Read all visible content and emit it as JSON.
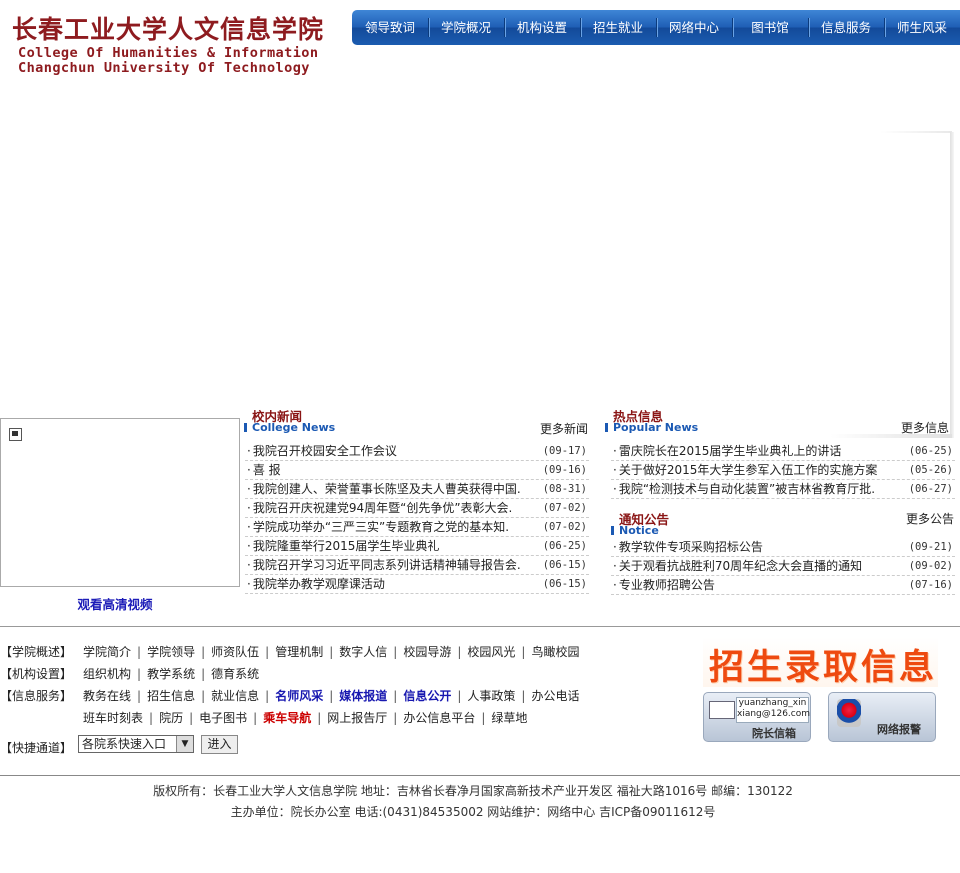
{
  "logo": {
    "name_cn": "长春工业大学人文信息学院",
    "name_en_1": "College Of Humanities & Information",
    "name_en_2": "Changchun University Of Technology"
  },
  "nav": [
    "领导致词",
    "学院概况",
    "机构设置",
    "招生就业",
    "网络中心",
    "图书馆",
    "信息服务",
    "师生风采"
  ],
  "video": {
    "link_label": "观看高清视频"
  },
  "campus_news": {
    "title_cn": "校内新闻",
    "title_en": "College News",
    "more": "更多新闻",
    "items": [
      {
        "title": "我院召开校园安全工作会议",
        "date": "(09-17)"
      },
      {
        "title": "喜 报",
        "date": "(09-16)"
      },
      {
        "title": "我院创建人、荣誉董事长陈坚及夫人曹英获得中国.",
        "date": "(08-31)"
      },
      {
        "title": "我院召开庆祝建党94周年暨“创先争优”表彰大会.",
        "date": "(07-02)"
      },
      {
        "title": "学院成功举办“三严三实”专题教育之党的基本知.",
        "date": "(07-02)"
      },
      {
        "title": "我院隆重举行2015届学生毕业典礼",
        "date": "(06-25)"
      },
      {
        "title": "我院召开学习习近平同志系列讲话精神辅导报告会.",
        "date": "(06-15)"
      },
      {
        "title": "我院举办教学观摩课活动",
        "date": "(06-15)"
      }
    ]
  },
  "hot_info": {
    "title_cn": "热点信息",
    "title_en": "Popular  News",
    "more": "更多信息",
    "items": [
      {
        "title": "雷庆院长在2015届学生毕业典礼上的讲话",
        "date": "(06-25)"
      },
      {
        "title": "关于做好2015年大学生参军入伍工作的实施方案",
        "date": "(05-26)"
      },
      {
        "title": "我院“检测技术与自动化装置”被吉林省教育厅批.",
        "date": "(06-27)"
      }
    ]
  },
  "notice": {
    "title_cn": "通知公告",
    "title_en": "Notice",
    "more": "更多公告",
    "items": [
      {
        "title": "教学软件专项采购招标公告",
        "date": "(09-21)"
      },
      {
        "title": "关于观看抗战胜利70周年纪念大会直播的通知",
        "date": "(09-02)"
      },
      {
        "title": "专业教师招聘公告",
        "date": "(07-16)"
      }
    ]
  },
  "quick_links": [
    {
      "label": "【学院概述】",
      "links": [
        {
          "t": "学院简介"
        },
        {
          "t": "学院领导"
        },
        {
          "t": "师资队伍"
        },
        {
          "t": "管理机制"
        },
        {
          "t": "数字人信"
        },
        {
          "t": "校园导游"
        },
        {
          "t": "校园风光"
        },
        {
          "t": "鸟瞰校园"
        }
      ]
    },
    {
      "label": "【机构设置】",
      "links": [
        {
          "t": "组织机构"
        },
        {
          "t": "教学系统"
        },
        {
          "t": "德育系统"
        }
      ]
    },
    {
      "label": "【信息服务】",
      "links": [
        {
          "t": "教务在线"
        },
        {
          "t": "招生信息"
        },
        {
          "t": "就业信息"
        },
        {
          "t": "名师风采",
          "s": "b"
        },
        {
          "t": "媒体报道",
          "s": "b"
        },
        {
          "t": "信息公开",
          "s": "b"
        },
        {
          "t": "人事政策"
        },
        {
          "t": "办公电话"
        }
      ]
    },
    {
      "label": "",
      "links": [
        {
          "t": "班车时刻表"
        },
        {
          "t": "院历"
        },
        {
          "t": "电子图书"
        },
        {
          "t": "乘车导航",
          "s": "r"
        },
        {
          "t": "网上报告厅"
        },
        {
          "t": "办公信息平台"
        },
        {
          "t": "绿草地"
        }
      ]
    }
  ],
  "quick_access": {
    "label": "【快捷通道】",
    "select_value": "各院系快速入口",
    "button": "进入"
  },
  "ads": {
    "recruit": "招生录取信息",
    "mailbox_email": "yuanzhang_xinxiang@126.com",
    "mailbox_email_1": "yuanzhang_xin",
    "mailbox_email_2": "xiang@126.com",
    "mailbox_caption": "院长信箱",
    "police_caption": "网络报警"
  },
  "footer": {
    "line1": "版权所有：长春工业大学人文信息学院   地址：吉林省长春净月国家高新技术产业开发区 福祉大路1016号  邮编：130122",
    "line2": "主办单位：院长办公室  电话:(0431)84535002 网站维护：网络中心 吉ICP备09011612号"
  }
}
